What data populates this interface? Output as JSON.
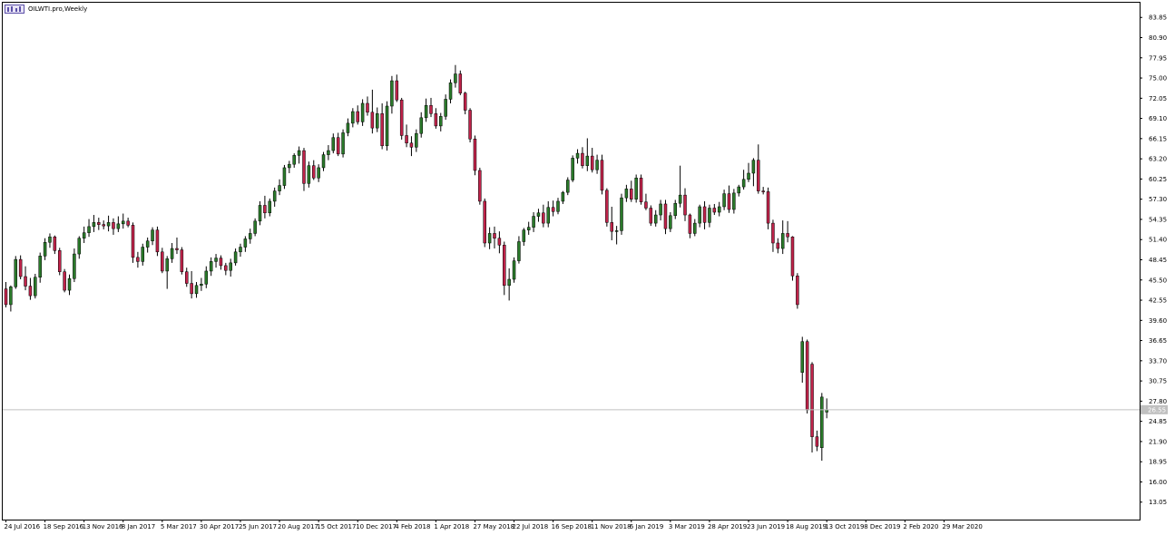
{
  "window": {
    "title": "OILWTI.pro,Weekly"
  },
  "colors": {
    "bull": "#2a7a2a",
    "bear": "#c0234a",
    "wick": "#000000",
    "grid_line": "#c0c0c0",
    "current_price_bg": "#c0c0c0",
    "background": "#ffffff",
    "icon": "#5b4fa8"
  },
  "icon": "chart-window-icon",
  "chart_data": {
    "type": "candlestick",
    "title": "OILWTI.pro,Weekly",
    "timeframe": "Weekly",
    "ylim": [
      10.5,
      86.0
    ],
    "y_ticks": [
      "83.85",
      "80.90",
      "77.95",
      "75.00",
      "72.05",
      "69.10",
      "66.15",
      "63.20",
      "60.25",
      "57.30",
      "54.35",
      "51.40",
      "48.45",
      "45.50",
      "42.55",
      "39.60",
      "36.65",
      "33.70",
      "30.75",
      "27.80",
      "24.85",
      "21.90",
      "18.95",
      "16.00",
      "13.05"
    ],
    "x_ticks": [
      {
        "label": "24 Jul 2016",
        "index": 0
      },
      {
        "label": "18 Sep 2016",
        "index": 8
      },
      {
        "label": "13 Nov 2016",
        "index": 16
      },
      {
        "label": "8 Jan 2017",
        "index": 24
      },
      {
        "label": "5 Mar 2017",
        "index": 32
      },
      {
        "label": "30 Apr 2017",
        "index": 40
      },
      {
        "label": "25 Jun 2017",
        "index": 48
      },
      {
        "label": "20 Aug 2017",
        "index": 56
      },
      {
        "label": "15 Oct 2017",
        "index": 64
      },
      {
        "label": "10 Dec 2017",
        "index": 72
      },
      {
        "label": "4 Feb 2018",
        "index": 80
      },
      {
        "label": "1 Apr 2018",
        "index": 88
      },
      {
        "label": "27 May 2018",
        "index": 96
      },
      {
        "label": "22 Jul 2018",
        "index": 104
      },
      {
        "label": "16 Sep 2018",
        "index": 112
      },
      {
        "label": "11 Nov 2018",
        "index": 120
      },
      {
        "label": "6 Jan 2019",
        "index": 128
      },
      {
        "label": "3 Mar 2019",
        "index": 136
      },
      {
        "label": "28 Apr 2019",
        "index": 144
      },
      {
        "label": "23 Jun 2019",
        "index": 152
      },
      {
        "label": "18 Aug 2019",
        "index": 160
      },
      {
        "label": "13 Oct 2019",
        "index": 168
      },
      {
        "label": "8 Dec 2019",
        "index": 176
      },
      {
        "label": "2 Feb 2020",
        "index": 184
      },
      {
        "label": "29 Mar 2020",
        "index": 192
      }
    ],
    "current_price": 26.55,
    "current_price_label": "26.55",
    "candles": [
      [
        44.2,
        45.2,
        41.5,
        41.9
      ],
      [
        41.9,
        44.7,
        40.9,
        44.5
      ],
      [
        44.5,
        49.0,
        44.2,
        48.5
      ],
      [
        48.5,
        49.1,
        45.6,
        46.0
      ],
      [
        46.0,
        47.5,
        44.0,
        44.6
      ],
      [
        44.6,
        45.8,
        42.6,
        43.2
      ],
      [
        43.2,
        46.4,
        42.8,
        45.9
      ],
      [
        45.9,
        49.5,
        45.1,
        49.0
      ],
      [
        49.0,
        51.6,
        48.4,
        51.0
      ],
      [
        51.0,
        52.3,
        50.2,
        51.8
      ],
      [
        51.8,
        52.0,
        49.3,
        49.8
      ],
      [
        49.8,
        50.2,
        46.2,
        46.7
      ],
      [
        46.7,
        47.1,
        43.7,
        44.0
      ],
      [
        44.0,
        46.3,
        43.3,
        45.7
      ],
      [
        45.7,
        50.1,
        45.2,
        49.3
      ],
      [
        49.3,
        51.9,
        48.6,
        51.6
      ],
      [
        51.6,
        53.3,
        50.9,
        52.4
      ],
      [
        52.4,
        54.4,
        51.8,
        53.3
      ],
      [
        53.3,
        55.0,
        52.5,
        53.9
      ],
      [
        53.9,
        54.6,
        52.8,
        53.6
      ],
      [
        53.6,
        54.2,
        52.9,
        53.4
      ],
      [
        53.4,
        54.9,
        52.6,
        53.9
      ],
      [
        53.9,
        54.5,
        52.1,
        53.0
      ],
      [
        53.0,
        54.8,
        52.5,
        53.7
      ],
      [
        53.7,
        55.2,
        53.0,
        54.1
      ],
      [
        54.1,
        54.6,
        53.2,
        53.5
      ],
      [
        53.5,
        53.9,
        48.0,
        48.8
      ],
      [
        48.8,
        49.6,
        47.3,
        48.2
      ],
      [
        48.2,
        50.8,
        47.6,
        50.3
      ],
      [
        50.3,
        51.7,
        49.5,
        51.2
      ],
      [
        51.2,
        53.2,
        50.6,
        52.8
      ],
      [
        52.8,
        53.3,
        49.0,
        49.6
      ],
      [
        49.6,
        50.2,
        46.5,
        46.8
      ],
      [
        46.8,
        49.0,
        44.2,
        48.6
      ],
      [
        48.6,
        50.9,
        48.0,
        50.1
      ],
      [
        50.1,
        51.7,
        49.3,
        49.9
      ],
      [
        49.9,
        50.3,
        46.3,
        46.7
      ],
      [
        46.7,
        47.3,
        44.5,
        45.0
      ],
      [
        45.0,
        46.8,
        42.8,
        43.5
      ],
      [
        43.5,
        45.2,
        42.9,
        44.7
      ],
      [
        44.7,
        45.8,
        43.9,
        44.9
      ],
      [
        44.9,
        47.5,
        44.3,
        46.8
      ],
      [
        46.8,
        48.8,
        46.1,
        48.2
      ],
      [
        48.2,
        49.3,
        47.3,
        48.7
      ],
      [
        48.7,
        49.1,
        47.0,
        47.6
      ],
      [
        47.6,
        48.0,
        46.2,
        46.9
      ],
      [
        46.9,
        48.6,
        46.0,
        48.0
      ],
      [
        48.0,
        50.1,
        47.6,
        49.6
      ],
      [
        49.6,
        50.8,
        48.9,
        50.3
      ],
      [
        50.3,
        51.9,
        49.6,
        51.5
      ],
      [
        51.5,
        53.0,
        50.8,
        52.3
      ],
      [
        52.3,
        54.5,
        51.9,
        54.1
      ],
      [
        54.1,
        57.0,
        53.5,
        56.4
      ],
      [
        56.4,
        57.8,
        54.5,
        55.3
      ],
      [
        55.3,
        57.4,
        54.8,
        57.0
      ],
      [
        57.0,
        59.0,
        56.2,
        58.5
      ],
      [
        58.5,
        60.2,
        57.9,
        59.3
      ],
      [
        59.3,
        62.3,
        58.8,
        61.9
      ],
      [
        61.9,
        62.9,
        61.1,
        62.4
      ],
      [
        62.4,
        64.0,
        61.9,
        63.7
      ],
      [
        63.7,
        65.0,
        62.5,
        64.4
      ],
      [
        64.4,
        64.8,
        58.5,
        59.6
      ],
      [
        59.6,
        62.8,
        59.0,
        62.2
      ],
      [
        62.2,
        63.0,
        60.1,
        60.4
      ],
      [
        60.4,
        62.4,
        59.8,
        61.9
      ],
      [
        61.9,
        64.2,
        61.4,
        63.8
      ],
      [
        63.8,
        65.2,
        63.0,
        64.4
      ],
      [
        64.4,
        66.9,
        64.0,
        66.3
      ],
      [
        66.3,
        67.0,
        63.6,
        63.9
      ],
      [
        63.9,
        67.5,
        63.4,
        67.0
      ],
      [
        67.0,
        69.1,
        66.5,
        68.4
      ],
      [
        68.4,
        70.6,
        67.8,
        70.1
      ],
      [
        70.1,
        71.0,
        68.2,
        68.6
      ],
      [
        68.6,
        71.9,
        68.0,
        71.3
      ],
      [
        71.3,
        72.3,
        69.5,
        70.0
      ],
      [
        70.0,
        73.3,
        66.9,
        67.7
      ],
      [
        67.7,
        70.7,
        67.1,
        69.8
      ],
      [
        69.8,
        71.3,
        64.6,
        65.1
      ],
      [
        65.1,
        71.6,
        64.4,
        70.9
      ],
      [
        70.9,
        75.3,
        69.8,
        74.6
      ],
      [
        74.6,
        75.5,
        71.5,
        71.8
      ],
      [
        71.8,
        72.1,
        66.0,
        66.6
      ],
      [
        66.6,
        68.2,
        64.9,
        65.5
      ],
      [
        65.5,
        66.5,
        63.6,
        64.9
      ],
      [
        64.9,
        67.5,
        64.2,
        66.9
      ],
      [
        66.9,
        70.0,
        66.3,
        69.2
      ],
      [
        69.2,
        72.0,
        68.6,
        71.0
      ],
      [
        71.0,
        72.1,
        69.3,
        69.8
      ],
      [
        69.8,
        70.6,
        67.6,
        68.0
      ],
      [
        68.0,
        69.9,
        67.2,
        69.4
      ],
      [
        69.4,
        72.6,
        68.9,
        71.9
      ],
      [
        71.9,
        74.8,
        71.3,
        74.3
      ],
      [
        74.3,
        76.9,
        73.6,
        75.6
      ],
      [
        75.6,
        76.1,
        72.5,
        72.8
      ],
      [
        72.8,
        73.0,
        69.7,
        70.3
      ],
      [
        70.3,
        70.6,
        65.6,
        66.1
      ],
      [
        66.1,
        66.6,
        60.8,
        61.5
      ],
      [
        61.5,
        61.9,
        56.5,
        57.0
      ],
      [
        57.0,
        57.4,
        50.3,
        50.9
      ],
      [
        50.9,
        53.2,
        50.0,
        52.3
      ],
      [
        52.3,
        53.3,
        50.1,
        51.6
      ],
      [
        51.6,
        52.6,
        49.4,
        50.6
      ],
      [
        50.6,
        51.1,
        43.3,
        44.7
      ],
      [
        44.7,
        47.2,
        42.5,
        45.6
      ],
      [
        45.6,
        48.8,
        45.1,
        48.3
      ],
      [
        48.3,
        51.9,
        47.9,
        51.1
      ],
      [
        51.1,
        53.1,
        50.5,
        52.8
      ],
      [
        52.8,
        54.0,
        52.1,
        53.2
      ],
      [
        53.2,
        55.4,
        52.5,
        54.8
      ],
      [
        54.8,
        55.9,
        54.0,
        55.3
      ],
      [
        55.3,
        56.5,
        53.2,
        53.8
      ],
      [
        53.8,
        57.0,
        53.2,
        56.1
      ],
      [
        56.1,
        57.1,
        54.8,
        55.5
      ],
      [
        55.5,
        57.5,
        55.1,
        57.0
      ],
      [
        57.0,
        58.5,
        56.6,
        58.3
      ],
      [
        58.3,
        60.5,
        57.9,
        60.1
      ],
      [
        60.1,
        63.7,
        59.8,
        63.3
      ],
      [
        63.3,
        64.6,
        62.5,
        64.0
      ],
      [
        64.0,
        64.9,
        61.8,
        62.2
      ],
      [
        62.2,
        66.2,
        61.4,
        63.6
      ],
      [
        63.6,
        64.8,
        61.2,
        61.6
      ],
      [
        61.6,
        63.8,
        61.0,
        63.0
      ],
      [
        63.0,
        63.8,
        58.0,
        58.6
      ],
      [
        58.6,
        58.9,
        53.3,
        53.9
      ],
      [
        53.9,
        56.2,
        51.3,
        52.6
      ],
      [
        52.6,
        53.4,
        50.7,
        52.7
      ],
      [
        52.7,
        58.1,
        52.1,
        57.5
      ],
      [
        57.5,
        59.4,
        56.9,
        58.8
      ],
      [
        58.8,
        60.0,
        56.9,
        57.3
      ],
      [
        57.3,
        60.9,
        56.8,
        60.4
      ],
      [
        60.4,
        60.9,
        56.5,
        56.9
      ],
      [
        56.9,
        58.1,
        55.7,
        56.0
      ],
      [
        56.0,
        56.4,
        53.4,
        53.8
      ],
      [
        53.8,
        55.7,
        53.3,
        55.0
      ],
      [
        55.0,
        57.2,
        54.2,
        56.6
      ],
      [
        56.6,
        57.2,
        52.2,
        53.0
      ],
      [
        53.0,
        55.4,
        52.5,
        54.9
      ],
      [
        54.9,
        57.2,
        54.4,
        56.7
      ],
      [
        56.7,
        62.2,
        56.1,
        57.9
      ],
      [
        57.9,
        58.9,
        54.1,
        55.0
      ],
      [
        55.0,
        55.2,
        51.6,
        52.3
      ],
      [
        52.3,
        54.4,
        51.9,
        53.8
      ],
      [
        53.8,
        56.5,
        53.2,
        56.2
      ],
      [
        56.2,
        57.0,
        52.9,
        53.9
      ],
      [
        53.9,
        56.5,
        53.2,
        56.0
      ],
      [
        56.0,
        56.6,
        55.0,
        55.4
      ],
      [
        55.4,
        56.9,
        54.8,
        56.2
      ],
      [
        56.2,
        58.7,
        55.7,
        58.1
      ],
      [
        58.1,
        59.3,
        55.3,
        55.8
      ],
      [
        55.8,
        58.8,
        55.2,
        58.2
      ],
      [
        58.2,
        59.4,
        57.7,
        59.1
      ],
      [
        59.1,
        61.6,
        58.7,
        60.2
      ],
      [
        60.2,
        62.6,
        59.8,
        61.1
      ],
      [
        61.1,
        63.3,
        59.2,
        63.0
      ],
      [
        63.0,
        65.3,
        58.1,
        58.5
      ],
      [
        58.5,
        59.1,
        58.0,
        58.4
      ],
      [
        58.4,
        59.0,
        52.9,
        53.8
      ],
      [
        53.8,
        54.3,
        49.6,
        50.9
      ],
      [
        50.9,
        51.6,
        49.4,
        50.1
      ],
      [
        50.1,
        54.2,
        49.3,
        52.3
      ],
      [
        52.3,
        54.1,
        51.0,
        51.8
      ],
      [
        51.8,
        51.9,
        45.4,
        46.1
      ],
      [
        46.1,
        46.5,
        41.3,
        41.9
      ],
      [
        32.0,
        37.2,
        30.5,
        36.5
      ],
      [
        36.5,
        36.8,
        26.0,
        26.5
      ],
      [
        33.2,
        33.5,
        20.3,
        22.6
      ],
      [
        22.6,
        23.5,
        20.5,
        21.2
      ],
      [
        21.0,
        29.0,
        19.1,
        28.4
      ],
      [
        26.2,
        28.2,
        25.3,
        26.55
      ]
    ]
  }
}
